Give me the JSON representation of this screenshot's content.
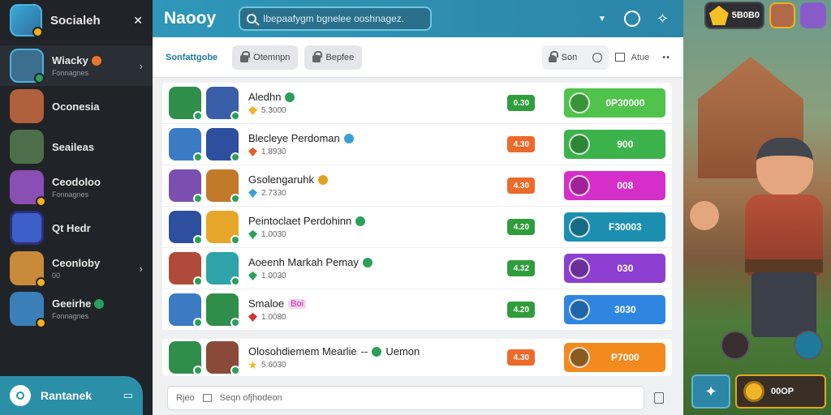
{
  "sidebar": {
    "title": "Socialeh",
    "items": [
      {
        "name": "Wiacky",
        "sub": "Fonnagnes",
        "badge_color": "#e8762b",
        "avatar_color": "#3c6e8f"
      },
      {
        "name": "Oconesia",
        "sub": "",
        "badge_color": "",
        "avatar_color": "#b0603a"
      },
      {
        "name": "Seaileas",
        "sub": "",
        "badge_color": "",
        "avatar_color": "#4c6f4a"
      },
      {
        "name": "Ceodoloo",
        "sub": "Fonnagnes",
        "badge_color": "",
        "avatar_color": "#8a4fb3"
      },
      {
        "name": "Qt Hedr",
        "sub": "",
        "badge_color": "",
        "avatar_color": "#3d5fc9"
      },
      {
        "name": "Ceonloby",
        "sub": "00",
        "badge_color": "",
        "avatar_color": "#c98a3a"
      },
      {
        "name": "Geeirhe",
        "sub": "Fonnagnes",
        "badge_color": "#2aa05a",
        "avatar_color": "#3b7fb8"
      }
    ],
    "bottom_label": "Rantanek"
  },
  "topbar": {
    "brand": "Naooy",
    "search_placeholder": "Ibepaafygm bgnelee ooshnagez."
  },
  "toolbar": {
    "link": "Sonfattgobe",
    "btn1": "Otemnpn",
    "btn2": "Bepfee",
    "sort": "Son",
    "view": "Atue"
  },
  "rows": [
    {
      "title": "Aledhn",
      "tag": "",
      "meta": "5.3000",
      "meta_icon_color": "#f0b52a",
      "pill": "0.30",
      "pill_color": "#2f9d3c",
      "action": "0P30000",
      "action_color": "#4fc34a",
      "avatar_colors": [
        "#2f8e4a",
        "#3a5fa8"
      ]
    },
    {
      "title": "Blecleye Perdoman",
      "tag": "",
      "meta": "1.8930",
      "meta_icon_color": "#e0602b",
      "pill": "4.30",
      "pill_color": "#ec6a2a",
      "action": "900",
      "action_color": "#3cb34a",
      "avatar_colors": [
        "#3a7bc4",
        "#2e4f9e"
      ]
    },
    {
      "title": "Gsolengaruhk",
      "tag": "",
      "meta": "2.7330",
      "meta_icon_color": "#3aa0d8",
      "pill": "4.30",
      "pill_color": "#ec6a2a",
      "action": "008",
      "action_color": "#d62ec9",
      "avatar_colors": [
        "#7b4fb0",
        "#c07a2a"
      ]
    },
    {
      "title": "Peintoclaet Perdohinn",
      "tag": "",
      "meta": "1.0030",
      "meta_icon_color": "#2aa05a",
      "pill": "4.20",
      "pill_color": "#2f9d3c",
      "action": "F30003",
      "action_color": "#1c8fb0",
      "avatar_colors": [
        "#2e4f9e",
        "#e6a62a"
      ]
    },
    {
      "title": "Aoeenh Markah Pemay",
      "tag": "",
      "meta": "1.0030",
      "meta_icon_color": "#2aa05a",
      "pill": "4.32",
      "pill_color": "#2f9d3c",
      "action": "030",
      "action_color": "#8c3fd0",
      "avatar_colors": [
        "#b04a3a",
        "#2ea4a8"
      ]
    },
    {
      "title": "Smaloe",
      "tag": "Boi",
      "meta": "1.0080",
      "meta_icon_color": "#d63030",
      "pill": "4.20",
      "pill_color": "#2f9d3c",
      "action": "3030",
      "action_color": "#2e86e0",
      "avatar_colors": [
        "#3a7bc4",
        "#2f8e4a"
      ]
    }
  ],
  "pinned_row": {
    "title": "Olosohdiemem Mearlie",
    "dash": "--",
    "tag": "Uemon",
    "meta": "5.6030",
    "meta_icon_color": "#f0b52a",
    "pill": "4.30",
    "pill_color": "#ec6a2a",
    "action": "P7000",
    "action_color": "#f28a1e",
    "avatar_colors": [
      "#2f8e4a",
      "#8a4a3a"
    ]
  },
  "composer": {
    "label1": "Rjeo",
    "label2": "Seqn ofjhodeon"
  },
  "hud": {
    "coins": "5B0B0",
    "gold": "00OP"
  }
}
